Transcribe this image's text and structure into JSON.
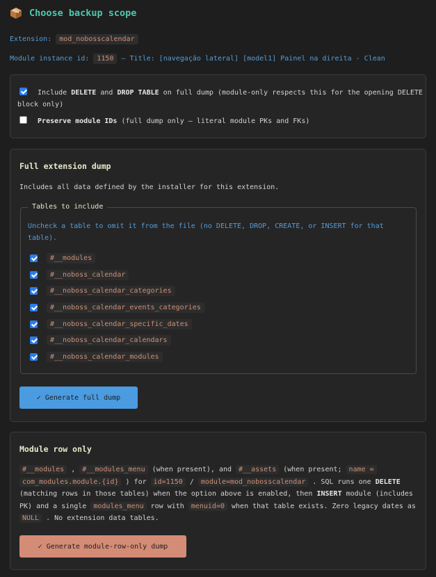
{
  "header": {
    "title": "Choose backup scope",
    "icon": "package-icon"
  },
  "meta": {
    "extension_label": "Extension:",
    "extension_value": "mod_nobosscalendar",
    "instance_label": "Module instance id:",
    "instance_value": "1150",
    "title_text": "— Title: [navegação lateral] [model1] Painel na direita - Clean"
  },
  "options": {
    "include_delete": {
      "checked": true,
      "pre": "Include ",
      "kw1": "DELETE",
      "mid": " and ",
      "kw2": "DROP TABLE",
      "post": " on full dump (module-only respects this for the opening DELETE",
      "post2": "block only)"
    },
    "preserve_ids": {
      "checked": false,
      "kw": "Preserve module IDs",
      "post": " (full dump only — literal module PKs and FKs)"
    }
  },
  "full_dump": {
    "title": "Full extension dump",
    "description": "Includes all data defined by the installer for this extension.",
    "legend": "Tables to include",
    "hint": "Uncheck a table to omit it from the file (no DELETE, DROP, CREATE, or INSERT for that table).",
    "tables": [
      {
        "name": "#__modules",
        "checked": true
      },
      {
        "name": "#__noboss_calendar",
        "checked": true
      },
      {
        "name": "#__noboss_calendar_categories",
        "checked": true
      },
      {
        "name": "#__noboss_calendar_events_categories",
        "checked": true
      },
      {
        "name": "#__noboss_calendar_specific_dates",
        "checked": true
      },
      {
        "name": "#__noboss_calendar_calendars",
        "checked": true
      },
      {
        "name": "#__noboss_calendar_modules",
        "checked": true
      }
    ],
    "button": "✓ Generate full dump"
  },
  "module_row": {
    "title": "Module row only",
    "t_modules": "#__modules",
    "sep1": " , ",
    "t_menu": "#__modules_menu",
    "txt1": " (when present), and ",
    "t_assets": "#__assets",
    "txt2": " (when present; ",
    "c_name": "name =",
    "c_name2": "com_modules.module.{id}",
    "txt3": " ) for ",
    "c_id": "id=1150",
    "txt4": " / ",
    "c_module": "module=mod_nobosscalendar",
    "txt5": " . SQL runs one ",
    "kw_delete": "DELETE",
    "txt6": "(matching rows in those tables) when the option above is enabled, then ",
    "kw_insert": "INSERT",
    "txt7": " module (includes",
    "txt8": "PK) and a single ",
    "c_menu": "modules_menu",
    "txt9": " row with ",
    "c_menuid": "menuid=0",
    "txt10": " when that table exists. Zero legacy dates as",
    "c_null": "NULL",
    "txt11": " . No extension data tables.",
    "button": "✓ Generate module-row-only dump"
  },
  "colors": {
    "background": "#1e1e1e",
    "panel": "#252526",
    "title": "#4ec9b0",
    "link_blue": "#569cd6",
    "code_orange": "#ce9178",
    "button_blue": "#4a9be0",
    "button_salmon": "#d48c76"
  }
}
